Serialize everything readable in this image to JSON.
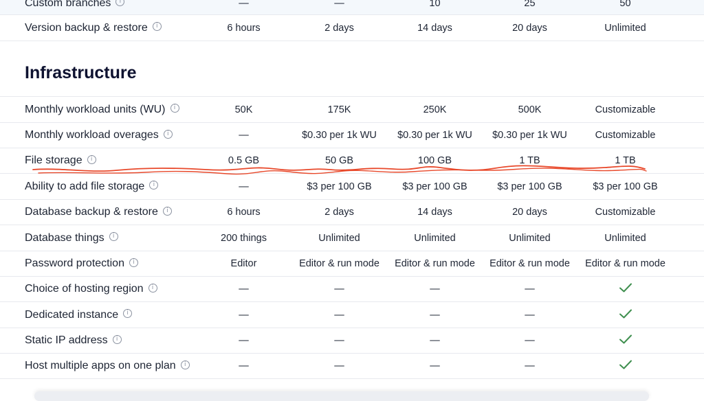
{
  "top_rows": [
    {
      "feature": "Custom branches",
      "values": [
        "—",
        "—",
        "10",
        "25",
        "50"
      ]
    },
    {
      "feature": "Version backup & restore",
      "values": [
        "6 hours",
        "2 days",
        "14 days",
        "20 days",
        "Unlimited"
      ]
    }
  ],
  "section": {
    "title": "Infrastructure"
  },
  "rows": [
    {
      "feature": "Monthly workload units (WU)",
      "values": [
        "50K",
        "175K",
        "250K",
        "500K",
        "Customizable"
      ]
    },
    {
      "feature": "Monthly workload overages",
      "values": [
        "—",
        "$0.30 per 1k WU",
        "$0.30 per 1k WU",
        "$0.30 per 1k WU",
        "Customizable"
      ]
    },
    {
      "feature": "File storage",
      "values": [
        "0.5 GB",
        "50 GB",
        "100 GB",
        "1 TB",
        "1 TB"
      ]
    },
    {
      "feature": "Ability to add file storage",
      "values": [
        "—",
        "$3 per 100 GB",
        "$3 per 100 GB",
        "$3 per 100 GB",
        "$3 per 100 GB"
      ]
    },
    {
      "feature": "Database backup & restore",
      "values": [
        "6 hours",
        "2 days",
        "14 days",
        "20 days",
        "Customizable"
      ]
    },
    {
      "feature": "Database things",
      "values": [
        "200 things",
        "Unlimited",
        "Unlimited",
        "Unlimited",
        "Unlimited"
      ]
    },
    {
      "feature": "Password protection",
      "values": [
        "Editor",
        "Editor & run mode",
        "Editor & run mode",
        "Editor & run mode",
        "Editor & run mode"
      ]
    },
    {
      "feature": "Choice of hosting region",
      "values": [
        "—",
        "—",
        "—",
        "—",
        ""
      ]
    },
    {
      "feature": "Dedicated instance",
      "values": [
        "—",
        "—",
        "—",
        "—",
        ""
      ]
    },
    {
      "feature": "Static IP address",
      "values": [
        "—",
        "—",
        "—",
        "—",
        ""
      ]
    },
    {
      "feature": "Host multiple apps on one plan",
      "values": [
        "—",
        "—",
        "—",
        "—",
        ""
      ]
    }
  ],
  "icons": {
    "info": "info-icon",
    "check": "checkmark-icon"
  },
  "colors": {
    "check": "#3f8f4f",
    "annotation": "#e8482a",
    "shaded_row": "#f4f8fc"
  }
}
